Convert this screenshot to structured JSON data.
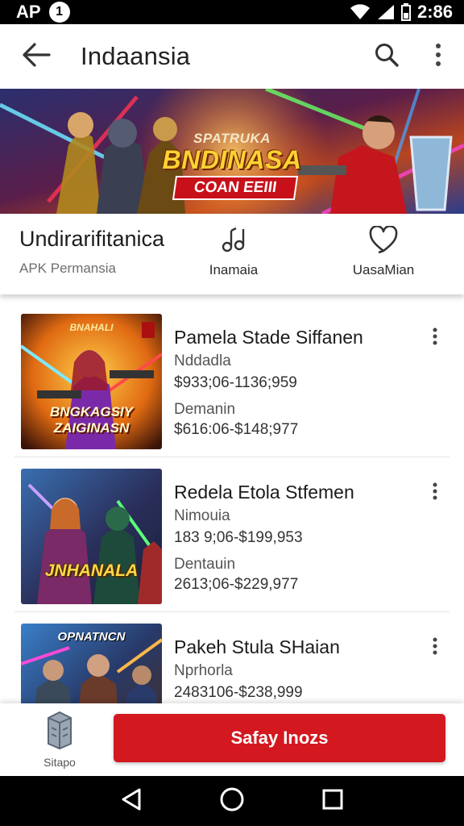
{
  "status_bar": {
    "left_text": "AP",
    "badge": "1",
    "time": "2:86",
    "icons": [
      "wifi-icon",
      "cell-signal-icon",
      "battery-icon"
    ]
  },
  "app_bar": {
    "title": "Indaansia",
    "icons": [
      "back-arrow-icon",
      "search-icon",
      "more-vert-icon"
    ]
  },
  "banner": {
    "top_text": "SPATRUKA",
    "title": "BNDINASA",
    "subtitle": "COAN EEIII"
  },
  "info_row": {
    "name": "Undirarifitanica",
    "subtitle": "APK Permansia",
    "music": {
      "icon": "music-note-icon",
      "label": "Inamaia"
    },
    "favorite": {
      "icon": "heart-icon",
      "label": "UasaMian"
    }
  },
  "items": [
    {
      "title": "Pamela Stade Siffanen",
      "line1_label": "Nddadla",
      "line1_price": "$933;06-1136;959",
      "line2_label": "Demanin",
      "line2_price": "$616:06-$148;977",
      "thumb_top": "BNAHALI",
      "thumb_text_1": "BNGKAGSIY",
      "thumb_text_2": "ZAIGINASN"
    },
    {
      "title": "Redela Etola Stfemen",
      "line1_label": "Nimouia",
      "line1_price": "183 9;06-$199,953",
      "line2_label": "Dentauin",
      "line2_price": "2613;06-$229,977",
      "thumb_text_1": "JNHANALA"
    },
    {
      "title": "Pakeh Stula SHaian",
      "line1_label": "Nprhorla",
      "line1_price": "2483106-$238,999",
      "thumb_text_1": "OPNATNCN"
    }
  ],
  "action_bar": {
    "shop_label": "Sitapo",
    "cta_label": "Safay Inozs"
  },
  "nav_bar": {
    "icons": [
      "nav-back-icon",
      "nav-home-icon",
      "nav-recents-icon"
    ]
  },
  "colors": {
    "accent": "#d3181f",
    "status_bar": "#000000",
    "banner_title": "#ffd233"
  }
}
